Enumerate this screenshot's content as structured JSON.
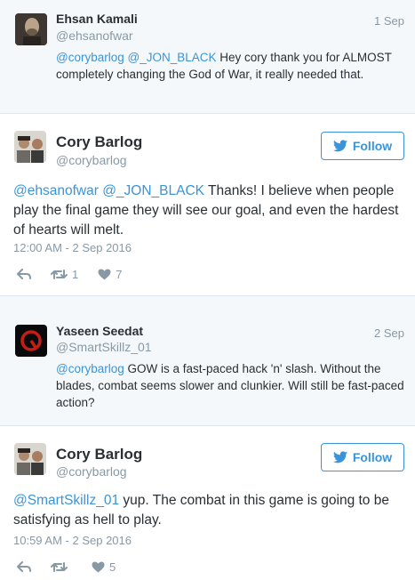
{
  "tweets": [
    {
      "kind": "reply",
      "name": "Ehsan Kamali",
      "handle": "@ehsanofwar",
      "date": "1 Sep",
      "text_parts": [
        {
          "t": "@corybarlog",
          "m": true
        },
        {
          "t": " ",
          "m": false
        },
        {
          "t": "@_JON_BLACK",
          "m": true
        },
        {
          "t": " Hey cory thank you for ALMOST completely changing the God of War, it really needed that.",
          "m": false
        }
      ]
    },
    {
      "kind": "main",
      "name": "Cory Barlog",
      "handle": "@corybarlog",
      "follow_label": "Follow",
      "text_parts": [
        {
          "t": "@ehsanofwar",
          "m": true
        },
        {
          "t": " ",
          "m": false
        },
        {
          "t": "@_JON_BLACK",
          "m": true
        },
        {
          "t": " Thanks! I believe when people play the final game they will see our goal, and even the hardest of hearts will melt.",
          "m": false
        }
      ],
      "timestamp": "12:00 AM - 2 Sep 2016",
      "retweets": "1",
      "likes": "7"
    },
    {
      "kind": "reply",
      "name": "Yaseen Seedat",
      "handle": "@SmartSkillz_01",
      "date": "2 Sep",
      "text_parts": [
        {
          "t": "@corybarlog",
          "m": true
        },
        {
          "t": " GOW is a fast-paced hack 'n' slash. Without the blades, combat seems slower and clunkier. Will still be fast-paced action?",
          "m": false
        }
      ]
    },
    {
      "kind": "main",
      "name": "Cory Barlog",
      "handle": "@corybarlog",
      "follow_label": "Follow",
      "text_parts": [
        {
          "t": "@SmartSkillz_01",
          "m": true
        },
        {
          "t": " yup. The combat in this game is going to be satisfying as hell to play.",
          "m": false
        }
      ],
      "timestamp": "10:59 AM - 2 Sep 2016",
      "retweets": "",
      "likes": "5"
    }
  ],
  "colors": {
    "link": "#3b94d9",
    "muted": "#8899a6",
    "text": "#292f33",
    "reply_bg": "#f5f8fa"
  },
  "icons": {
    "reply": "reply-icon",
    "retweet": "retweet-icon",
    "like": "heart-icon",
    "follow": "twitter-bird-icon"
  }
}
